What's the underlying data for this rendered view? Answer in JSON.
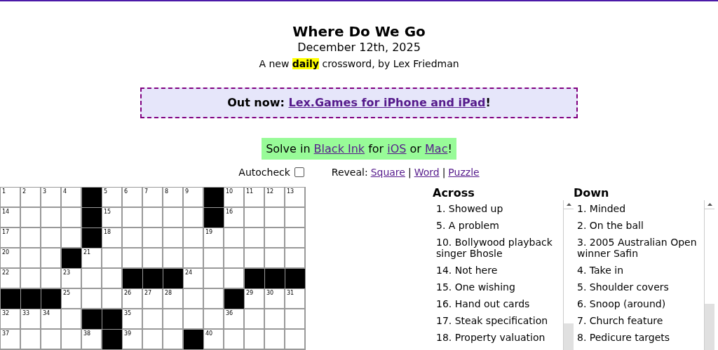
{
  "header": {
    "title": "Where Do We Go",
    "date": "December 12th, 2025",
    "tagline": "A new **daily** crossword, by Lex Friedman"
  },
  "banner": [
    {
      "kind": "text",
      "text": "Out now: "
    },
    {
      "kind": "link",
      "text": "Lex.Games for iPhone and iPad"
    },
    {
      "kind": "text",
      "text": "!"
    }
  ],
  "solve_note": [
    {
      "kind": "text",
      "text": "Solve in "
    },
    {
      "kind": "link",
      "text": "Black Ink"
    },
    {
      "kind": "text",
      "text": " for "
    },
    {
      "kind": "link",
      "text": "iOS"
    },
    {
      "kind": "text",
      "text": " or "
    },
    {
      "kind": "link",
      "text": "Mac"
    },
    {
      "kind": "text",
      "text": "!"
    }
  ],
  "autocheck": {
    "label": "Autocheck",
    "checked": false
  },
  "reveal": [
    {
      "kind": "text",
      "text": "Reveal:"
    },
    {
      "kind": "link",
      "text": "Square"
    },
    {
      "kind": "separator",
      "text": "|"
    },
    {
      "kind": "link",
      "text": "Word"
    },
    {
      "kind": "separator",
      "text": "|"
    },
    {
      "kind": "link",
      "text": "Puzzle"
    }
  ],
  "grid": [
    [
      {
        "kind": "square",
        "number": "1"
      },
      {
        "kind": "square",
        "number": "2"
      },
      {
        "kind": "square",
        "number": "3"
      },
      {
        "kind": "square",
        "number": "4"
      },
      {
        "kind": "block"
      },
      {
        "kind": "square",
        "number": "5"
      },
      {
        "kind": "square",
        "number": "6"
      },
      {
        "kind": "square",
        "number": "7"
      },
      {
        "kind": "square",
        "number": "8"
      },
      {
        "kind": "square",
        "number": "9"
      },
      {
        "kind": "block"
      },
      {
        "kind": "square",
        "number": "10"
      },
      {
        "kind": "square",
        "number": "11"
      },
      {
        "kind": "square",
        "number": "12"
      },
      {
        "kind": "square",
        "number": "13"
      }
    ],
    [
      {
        "kind": "square",
        "number": "14"
      },
      {
        "kind": "square"
      },
      {
        "kind": "square"
      },
      {
        "kind": "square"
      },
      {
        "kind": "block"
      },
      {
        "kind": "square",
        "number": "15"
      },
      {
        "kind": "square"
      },
      {
        "kind": "square"
      },
      {
        "kind": "square"
      },
      {
        "kind": "square"
      },
      {
        "kind": "block"
      },
      {
        "kind": "square",
        "number": "16"
      },
      {
        "kind": "square"
      },
      {
        "kind": "square"
      },
      {
        "kind": "square"
      }
    ],
    [
      {
        "kind": "square",
        "number": "17"
      },
      {
        "kind": "square"
      },
      {
        "kind": "square"
      },
      {
        "kind": "square"
      },
      {
        "kind": "block"
      },
      {
        "kind": "square",
        "number": "18"
      },
      {
        "kind": "square"
      },
      {
        "kind": "square"
      },
      {
        "kind": "square"
      },
      {
        "kind": "square"
      },
      {
        "kind": "square",
        "number": "19"
      },
      {
        "kind": "square"
      },
      {
        "kind": "square"
      },
      {
        "kind": "square"
      },
      {
        "kind": "square"
      }
    ],
    [
      {
        "kind": "square",
        "number": "20"
      },
      {
        "kind": "square"
      },
      {
        "kind": "square"
      },
      {
        "kind": "block"
      },
      {
        "kind": "square",
        "number": "21"
      },
      {
        "kind": "square"
      },
      {
        "kind": "square"
      },
      {
        "kind": "square"
      },
      {
        "kind": "square"
      },
      {
        "kind": "square"
      },
      {
        "kind": "square"
      },
      {
        "kind": "square"
      },
      {
        "kind": "square"
      },
      {
        "kind": "square"
      },
      {
        "kind": "square"
      }
    ],
    [
      {
        "kind": "square",
        "number": "22"
      },
      {
        "kind": "square"
      },
      {
        "kind": "square"
      },
      {
        "kind": "square",
        "number": "23"
      },
      {
        "kind": "square"
      },
      {
        "kind": "square"
      },
      {
        "kind": "block"
      },
      {
        "kind": "block"
      },
      {
        "kind": "block"
      },
      {
        "kind": "square",
        "number": "24"
      },
      {
        "kind": "square"
      },
      {
        "kind": "square"
      },
      {
        "kind": "block"
      },
      {
        "kind": "block"
      },
      {
        "kind": "block"
      }
    ],
    [
      {
        "kind": "block"
      },
      {
        "kind": "block"
      },
      {
        "kind": "block"
      },
      {
        "kind": "square",
        "number": "25"
      },
      {
        "kind": "square"
      },
      {
        "kind": "square"
      },
      {
        "kind": "square",
        "number": "26"
      },
      {
        "kind": "square",
        "number": "27"
      },
      {
        "kind": "square",
        "number": "28"
      },
      {
        "kind": "square"
      },
      {
        "kind": "square"
      },
      {
        "kind": "block"
      },
      {
        "kind": "square",
        "number": "29"
      },
      {
        "kind": "square",
        "number": "30"
      },
      {
        "kind": "square",
        "number": "31"
      }
    ],
    [
      {
        "kind": "square",
        "number": "32"
      },
      {
        "kind": "square",
        "number": "33"
      },
      {
        "kind": "square",
        "number": "34"
      },
      {
        "kind": "square"
      },
      {
        "kind": "block"
      },
      {
        "kind": "block"
      },
      {
        "kind": "square",
        "number": "35"
      },
      {
        "kind": "square"
      },
      {
        "kind": "square"
      },
      {
        "kind": "square"
      },
      {
        "kind": "square"
      },
      {
        "kind": "square",
        "number": "36"
      },
      {
        "kind": "square"
      },
      {
        "kind": "square"
      },
      {
        "kind": "square"
      }
    ],
    [
      {
        "kind": "square",
        "number": "37"
      },
      {
        "kind": "square"
      },
      {
        "kind": "square"
      },
      {
        "kind": "square"
      },
      {
        "kind": "square",
        "number": "38"
      },
      {
        "kind": "block"
      },
      {
        "kind": "square",
        "number": "39"
      },
      {
        "kind": "square"
      },
      {
        "kind": "square"
      },
      {
        "kind": "block"
      },
      {
        "kind": "square",
        "number": "40"
      },
      {
        "kind": "square"
      },
      {
        "kind": "square"
      },
      {
        "kind": "square"
      },
      {
        "kind": "square"
      }
    ]
  ],
  "across": {
    "heading": "Across",
    "clues": [
      "1. Showed up",
      "5. A problem",
      "10. Bollywood playback singer Bhosle",
      "14. Not here",
      "15. One wishing",
      "16. Hand out cards",
      "17. Steak specification",
      "18. Property valuation"
    ]
  },
  "down": {
    "heading": "Down",
    "clues": [
      "1. Minded",
      "2. On the ball",
      "3. 2005 Australian Open winner Safin",
      "4. Take in",
      "5. Shoulder covers",
      "6. Snoop (around)",
      "7. Church feature",
      "8. Pedicure targets"
    ]
  }
}
